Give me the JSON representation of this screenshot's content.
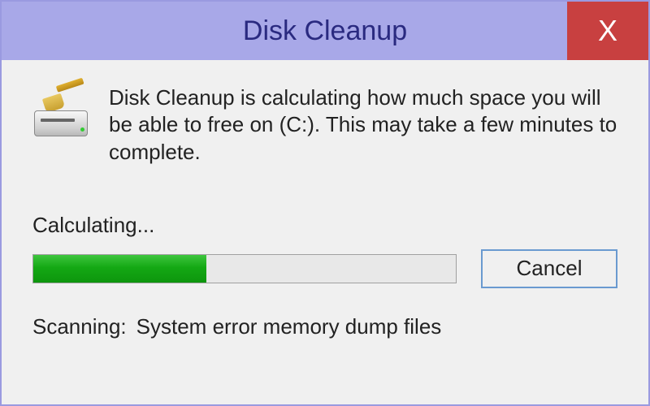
{
  "title": "Disk Cleanup",
  "close_label": "X",
  "message": "Disk Cleanup is calculating how much space you will be able to free on  (C:). This may take a few minutes to complete.",
  "status_label": "Calculating...",
  "progress_percent": 41,
  "cancel_label": "Cancel",
  "scanning_label": "Scanning:",
  "scanning_item": "System error memory dump files",
  "icon": "disk-cleanup-icon",
  "colors": {
    "titlebar_bg": "#a8a8e8",
    "close_bg": "#c84040",
    "progress_fill": "#14a814",
    "button_border": "#6a9ad0"
  }
}
